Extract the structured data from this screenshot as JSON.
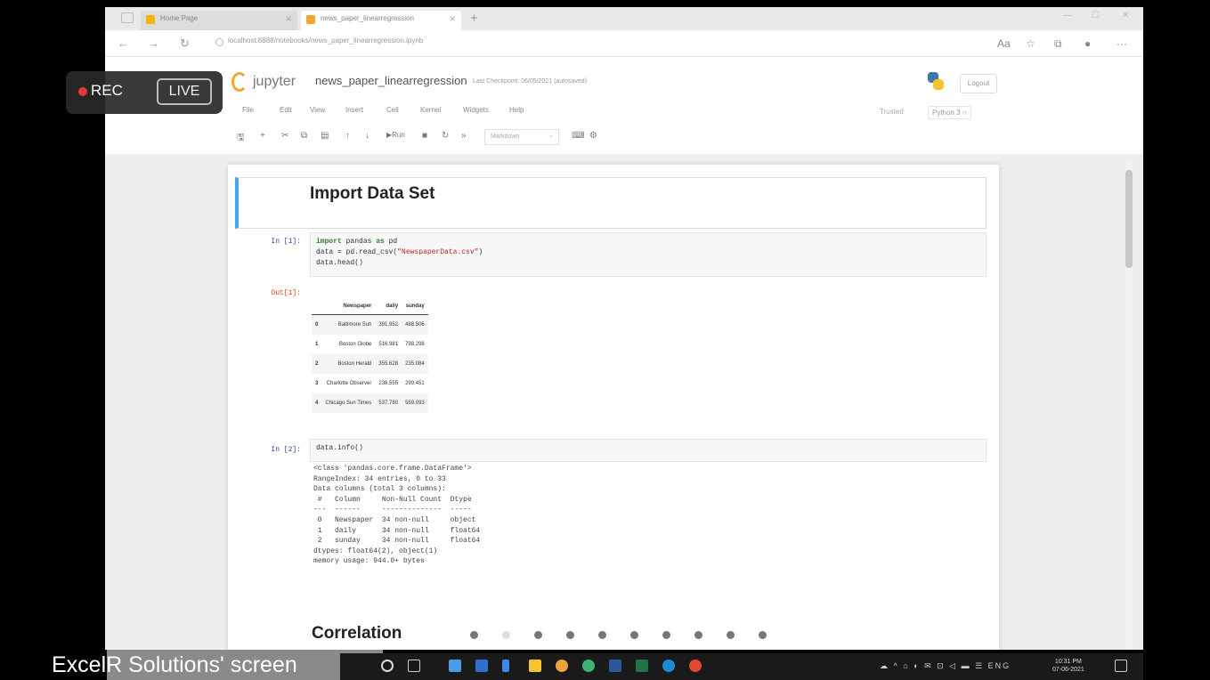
{
  "recording": {
    "rec_label": "REC",
    "live_label": "LIVE"
  },
  "notebook": {
    "logo_text": "jupyter",
    "name": "news_paper_linearregression",
    "checkpoint": "Last Checkpoint: 06/05/2021  (autosaved)",
    "logout_label": "Logout",
    "menu": [
      "File",
      "Edit",
      "View",
      "Insert",
      "Cell",
      "Kernel",
      "Widgets",
      "Help"
    ],
    "trusted_label": "Trusted",
    "kernel_label": "Python 3 ○",
    "toolbar": {
      "run_label": "Run",
      "cell_type": "Markdown"
    }
  },
  "cells": {
    "heading1": "Import Data Set",
    "in1_prompt": "In [1]:",
    "in1_code": [
      "import pandas as pd",
      "data = pd.read_csv(\"NewspaperData.csv\")",
      "data.head()"
    ],
    "out1_prompt": "Out[1]:",
    "table": {
      "columns": [
        "",
        "Newspaper",
        "daily",
        "sunday"
      ],
      "rows": [
        [
          "0",
          "Baltimore Sun",
          "391.952",
          "488.506"
        ],
        [
          "1",
          "Boston Globe",
          "516.981",
          "798.298"
        ],
        [
          "2",
          "Boston Herald",
          "355.628",
          "235.084"
        ],
        [
          "3",
          "Charlotte Observer",
          "238.555",
          "299.451"
        ],
        [
          "4",
          "Chicago Sun Times",
          "537.780",
          "559.093"
        ]
      ]
    },
    "in2_prompt": "In [2]:",
    "in2_code": "data.info()",
    "info_output": "<class 'pandas.core.frame.DataFrame'>\nRangeIndex: 34 entries, 0 to 33\nData columns (total 3 columns):\n #   Column     Non-Null Count  Dtype  \n---  ------     --------------  -----  \n 0   Newspaper  34 non-null     object \n 1   daily      34 non-null     float64\n 2   sunday     34 non-null     float64\ndtypes: float64(2), object(1)\nmemory usage: 944.0+ bytes",
    "heading2": "Correlation"
  },
  "overlay": {
    "screen_label": "ExcelR Solutions' screen"
  },
  "taskbar": {
    "time": "10:31 PM",
    "date": "07-06-2021"
  },
  "colors": {
    "rec": "#e53935",
    "jupyter_orange": "#f0a531",
    "md_border": "#42a5f5"
  }
}
